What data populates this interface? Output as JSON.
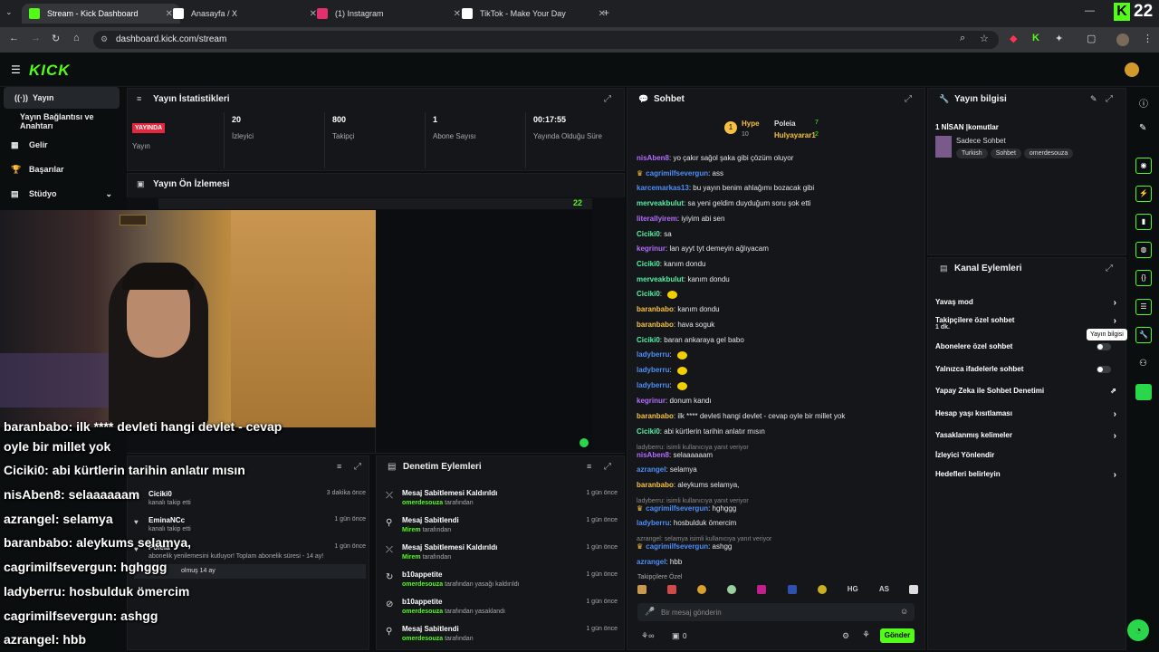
{
  "browser": {
    "tabs": [
      {
        "title": "Stream - Kick Dashboard",
        "icon": "kick-icon",
        "color": "#53fc18",
        "active": true
      },
      {
        "title": "Anasayfa / X",
        "icon": "x-icon",
        "color": "#ffffff",
        "active": false
      },
      {
        "title": "(1) Instagram",
        "icon": "instagram-icon",
        "color": "#e1306c",
        "active": false
      },
      {
        "title": "TikTok - Make Your Day",
        "icon": "tiktok-icon",
        "color": "#ffffff",
        "active": false
      }
    ],
    "url": "dashboard.kick.com/stream",
    "corner_badge": "22"
  },
  "header": {
    "logo": "KICK"
  },
  "sidebar": {
    "items": [
      {
        "label": "Yayın",
        "icon": "broadcast-icon"
      },
      {
        "label": "Yayın Bağlantısı ve Anahtarı",
        "icon": ""
      },
      {
        "label": "Gelir",
        "icon": "revenue-icon"
      },
      {
        "label": "Başarılar",
        "icon": "trophy-icon"
      },
      {
        "label": "Stüdyo",
        "icon": "studio-icon"
      }
    ]
  },
  "stats": {
    "title": "Yayın İstatistikleri",
    "live_badge": "YAYINDA",
    "live_label": "Yayın",
    "viewers": "20",
    "viewers_label": "İzleyici",
    "followers": "800",
    "followers_label": "Takipçi",
    "subs": "1",
    "subs_label": "Abone Sayısı",
    "uptime": "00:17:55",
    "uptime_label": "Yayında Olduğu Süre"
  },
  "preview": {
    "title": "Yayın Ön İzlemesi",
    "overlay": [
      {
        "user": "baranbabo",
        "msg": ": ilk **** devleti hangi devlet - cevap"
      },
      {
        "user": "",
        "msg": "oyle bir millet yok"
      },
      {
        "user": "Ciciki0",
        "msg": ": abi kürtlerin tarihin anlatır mısın"
      },
      {
        "user": "nisAben8",
        "msg": ": selaaaaaam"
      },
      {
        "user": "azrangel",
        "msg": ": selamya"
      },
      {
        "user": "baranbabo",
        "msg": ": aleykums selamya,"
      },
      {
        "user": "cagrimilfsevergun",
        "msg": ": hghggg"
      },
      {
        "user": "ladyberru",
        "msg": ": hosbulduk ömercim"
      },
      {
        "user": "cagrimilfsevergun",
        "msg": ": ashgg"
      },
      {
        "user": "azrangel",
        "msg": ": hbb"
      }
    ]
  },
  "activity": [
    {
      "name": "Ciciki0",
      "sub": "kanalı takip etti",
      "time": "3 dakika önce"
    },
    {
      "name": "EminaNCc",
      "sub": "kanalı takip etti",
      "time": "1 gün önce"
    },
    {
      "name": "Poleia",
      "sub": "abonelik yenilemesini kutluyor! Toplam abonelik süresi - 14 ay!",
      "time": "1 gün önce"
    }
  ],
  "activity_extra": "olmuş 14 ay",
  "moderation": {
    "title": "Denetim Eylemleri",
    "items": [
      {
        "title": "Mesaj Sabitlemesi Kaldırıldı",
        "by": "omerdesouza",
        "suffix": " tarafından",
        "time": "1 gün önce",
        "icon": "unpin-icon"
      },
      {
        "title": "Mesaj Sabitlendi",
        "by": "Mirem",
        "suffix": " tarafından",
        "time": "1 gün önce",
        "icon": "pin-icon"
      },
      {
        "title": "Mesaj Sabitlemesi Kaldırıldı",
        "by": "Mirem",
        "suffix": " tarafından",
        "time": "1 gün önce",
        "icon": "unpin-icon"
      },
      {
        "title": "b10appetite",
        "by": "omerdesouza",
        "suffix": " tarafından yasağı kaldırıldı",
        "time": "1 gün önce",
        "icon": "unban-icon"
      },
      {
        "title": "b10appetite",
        "by": "omerdesouza",
        "suffix": " tarafından yasaklandı",
        "time": "1 gün önce",
        "icon": "ban-icon"
      },
      {
        "title": "Mesaj Sabitlendi",
        "by": "omerdesouza",
        "suffix": " tarafından",
        "time": "1 gün önce",
        "icon": "pin-icon"
      }
    ]
  },
  "chat": {
    "title": "Sohbet",
    "hype_label": "Hype",
    "hype_count": "10",
    "top_users": [
      {
        "name": "Poleia",
        "count": "7"
      },
      {
        "name": "Hulyayarar1",
        "count": "2"
      }
    ],
    "messages": [
      {
        "user": "nisAben8",
        "cls": "c-pur",
        "text": "yo çakır sağol şaka gibi çözüm oluyor"
      },
      {
        "user": "cagrimilfsevergun",
        "cls": "c-blu",
        "text": "ass",
        "badge": true
      },
      {
        "user": "karcemarkas13",
        "cls": "c-blu",
        "text": "bu yayın benim ahlağımı bozacak gibi"
      },
      {
        "user": "merveakbulut",
        "cls": "c-grn",
        "text": "sa yeni geldim duyduğum soru şok etti"
      },
      {
        "user": "literallyirem",
        "cls": "c-pur",
        "text": "iyiyim abi sen"
      },
      {
        "user": "Ciciki0",
        "cls": "c-grn",
        "text": "sa"
      },
      {
        "user": "kegrinur",
        "cls": "c-pur",
        "text": "lan ayyt tyt demeyin ağlıyacam"
      },
      {
        "user": "Ciciki0",
        "cls": "c-grn",
        "text": "kanım dondu"
      },
      {
        "user": "merveakbulut",
        "cls": "c-grn",
        "text": "kanım dondu"
      },
      {
        "user": "Ciciki0",
        "cls": "c-grn",
        "text": "",
        "emoji": true
      },
      {
        "user": "baranbabo",
        "cls": "c-yel",
        "text": "kanım dondu"
      },
      {
        "user": "baranbabo",
        "cls": "c-yel",
        "text": "hava soguk"
      },
      {
        "user": "Ciciki0",
        "cls": "c-grn",
        "text": "baran ankaraya gel babo"
      },
      {
        "user": "ladyberru",
        "cls": "c-blu",
        "text": "",
        "emoji": true
      },
      {
        "user": "ladyberru",
        "cls": "c-blu",
        "text": "",
        "emoji": true
      },
      {
        "user": "ladyberru",
        "cls": "c-blu",
        "text": "",
        "emoji": true
      },
      {
        "user": "kegrinur",
        "cls": "c-pur",
        "text": "donum kandı"
      },
      {
        "user": "baranbabo",
        "cls": "c-yel",
        "text": "ilk **** devleti hangi devlet - cevap oyle bir millet yok"
      },
      {
        "user": "Ciciki0",
        "cls": "c-grn",
        "text": "abi kürtlerin tarihin anlatır mısın"
      },
      {
        "user": "",
        "cls": "c-sys",
        "text": "ladyberru: isimli kullanıcıya yanıt veriyor",
        "sys": true
      },
      {
        "user": "nisAben8",
        "cls": "c-pur",
        "text": "selaaaaaam"
      },
      {
        "user": "azrangel",
        "cls": "c-blu",
        "text": "selamya"
      },
      {
        "user": "baranbabo",
        "cls": "c-yel",
        "text": "aleykums selamya,"
      },
      {
        "user": "",
        "cls": "c-sys",
        "text": "ladyberru: isimli kullanıcıya yanıt veriyor",
        "sys": true
      },
      {
        "user": "cagrimilfsevergun",
        "cls": "c-blu",
        "text": "hghggg",
        "badge": true
      },
      {
        "user": "ladyberru",
        "cls": "c-blu",
        "text": "hosbulduk ömercim"
      },
      {
        "user": "",
        "cls": "c-sys",
        "text": "azrangel: selamya isimli kullanıcıya yanıt veriyor",
        "sys": true
      },
      {
        "user": "cagrimilfsevergun",
        "cls": "c-blu",
        "text": "ashgg",
        "badge": true
      },
      {
        "user": "azrangel",
        "cls": "c-blu",
        "text": "hbb"
      }
    ],
    "follower_only": "Takipçilere Özel",
    "input_placeholder": "Bir mesaj gönderin",
    "send_label": "Gönder",
    "viewer_count": "0",
    "other_count": "0"
  },
  "info": {
    "title": "Yayın bilgisi",
    "stream_title": "1 NİSAN |komutlar",
    "category": "Sadece Sohbet",
    "tags": [
      "Turkish",
      "Sohbet",
      "omerdesouza"
    ]
  },
  "channel_actions": {
    "title": "Kanal Eylemleri",
    "items": [
      {
        "label": "Yavaş mod",
        "type": "chevron"
      },
      {
        "label": "Takipçilere özel sohbet",
        "sub": "1 dk.",
        "type": "chevron"
      },
      {
        "label": "Abonelere özel sohbet",
        "type": "toggle"
      },
      {
        "label": "Yalnızca ifadelerle sohbet",
        "type": "toggle"
      },
      {
        "label": "Yapay Zeka ile Sohbet Denetimi",
        "type": "external"
      },
      {
        "label": "Hesap yaşı kısıtlaması",
        "type": "chevron"
      },
      {
        "label": "Yasaklanmış kelimeler",
        "type": "chevron"
      },
      {
        "label": "İzleyici Yönlendir",
        "type": "none"
      },
      {
        "label": "Hedefleri belirleyin",
        "type": "chevron"
      }
    ],
    "tooltip": "Yayın bilgisi"
  }
}
